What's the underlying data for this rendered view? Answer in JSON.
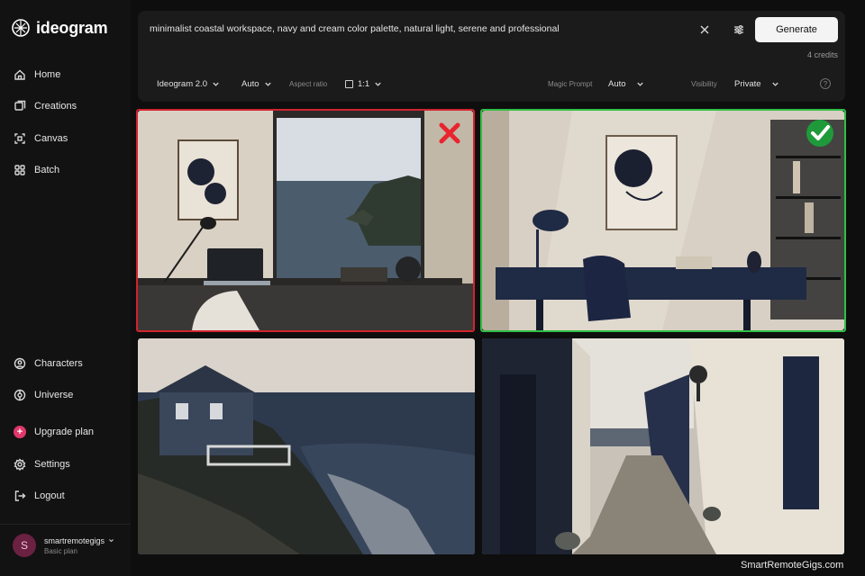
{
  "app": {
    "logo_text": "ideogram"
  },
  "sidebar": {
    "items": [
      {
        "label": "Home",
        "icon": "home-icon"
      },
      {
        "label": "Creations",
        "icon": "creations-icon"
      },
      {
        "label": "Canvas",
        "icon": "canvas-icon"
      },
      {
        "label": "Batch",
        "icon": "batch-icon"
      }
    ],
    "bottom_items": [
      {
        "label": "Characters",
        "icon": "characters-icon"
      },
      {
        "label": "Universe",
        "icon": "universe-icon"
      },
      {
        "label": "Upgrade plan",
        "icon": "plus-icon"
      },
      {
        "label": "Settings",
        "icon": "gear-icon"
      },
      {
        "label": "Logout",
        "icon": "logout-icon"
      }
    ],
    "user": {
      "initial": "S",
      "name": "smartremotegigs",
      "plan": "Basic plan"
    }
  },
  "prompt": {
    "text": "minimalist coastal workspace, navy and cream color palette, natural light, serene and professional",
    "generate_label": "Generate",
    "credits": "4 credits"
  },
  "options": {
    "model": "Ideogram 2.0",
    "style": "Auto",
    "aspect_label": "Aspect ratio",
    "aspect_value": "1:1",
    "magic_label": "Magic Prompt",
    "magic_value": "Auto",
    "visibility_label": "Visibility",
    "visibility_value": "Private",
    "help": "?"
  },
  "results": [
    {
      "name": "coastal-office-window",
      "marked": "rejected"
    },
    {
      "name": "navy-desk-office",
      "marked": "approved"
    },
    {
      "name": "cliff-house-ocean",
      "marked": "none"
    },
    {
      "name": "seaside-alley",
      "marked": "none"
    }
  ],
  "colors": {
    "accent_red": "#d0242e",
    "accent_green": "#2fbf45",
    "upgrade": "#e0386a"
  },
  "watermark": "SmartRemoteGigs.com"
}
